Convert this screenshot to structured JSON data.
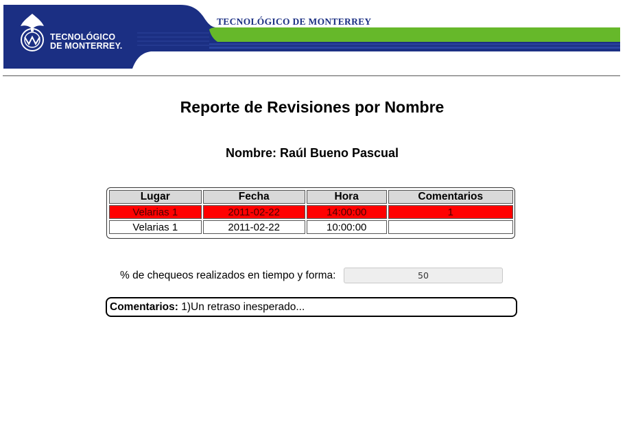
{
  "header": {
    "logo_line1": "TECNOLÓGICO",
    "logo_line2": "DE MONTERREY.",
    "banner_title": "TECNOLÓGICO DE MONTERREY",
    "colors": {
      "navy": "#1b2f83",
      "green": "#66b82a"
    }
  },
  "page": {
    "title": "Reporte de Revisiones por Nombre",
    "name_label": "Nombre:",
    "name_value": "Raúl Bueno Pascual"
  },
  "table": {
    "columns": [
      "Lugar",
      "Fecha",
      "Hora",
      "Comentarios"
    ],
    "rows": [
      {
        "lugar": "Velarias 1",
        "fecha": "2011-02-22",
        "hora": "14:00:00",
        "comentarios": "1",
        "highlight": "#ff0000"
      },
      {
        "lugar": "Velarias 1",
        "fecha": "2011-02-22",
        "hora": "10:00:00",
        "comentarios": ""
      }
    ]
  },
  "percent": {
    "label": "% de chequeos realizados en tiempo y forma:",
    "value": "50"
  },
  "comments": {
    "label": "Comentarios:",
    "text": "1)Un retraso inesperado..."
  }
}
